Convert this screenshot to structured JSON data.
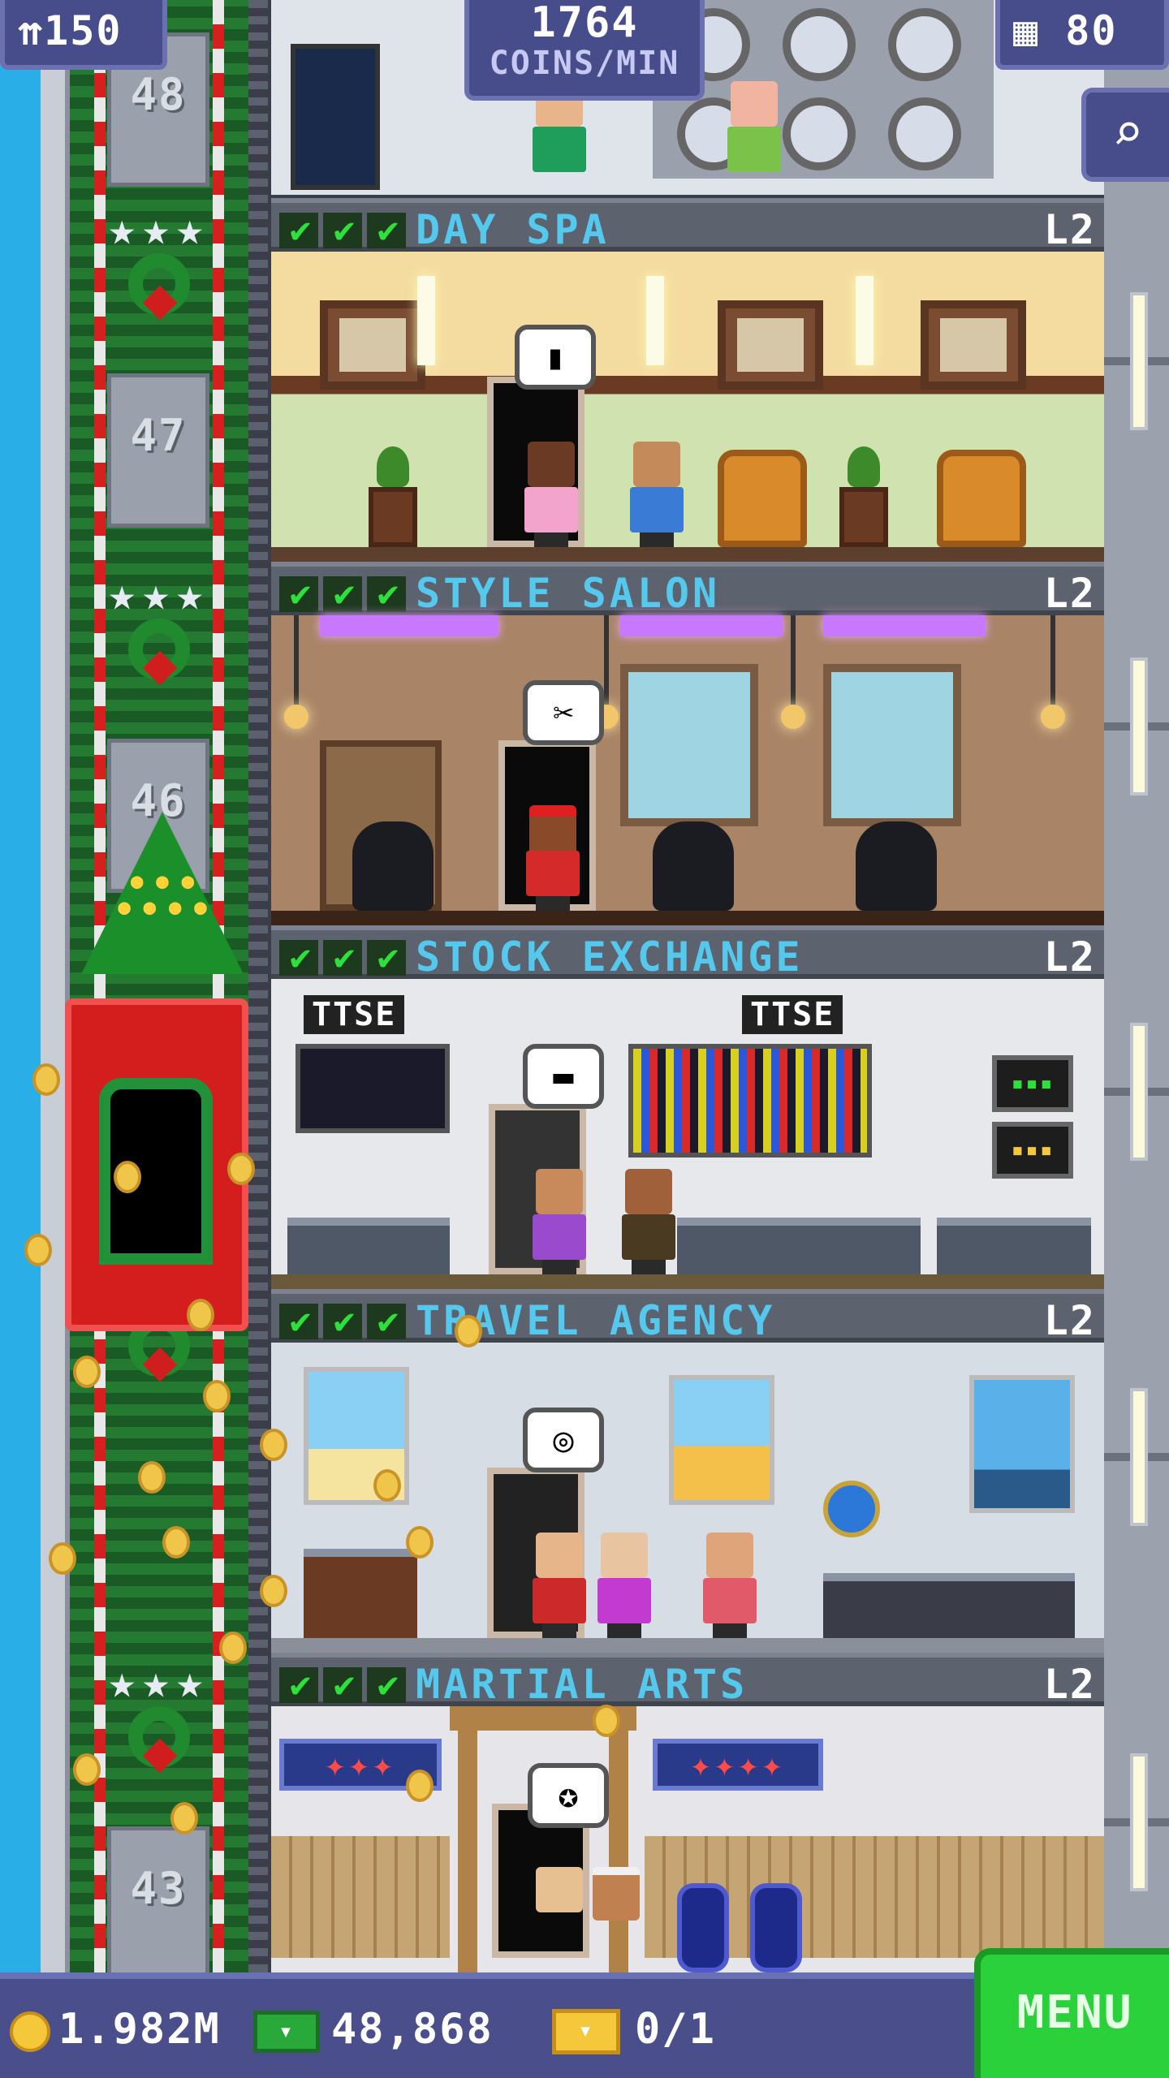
{
  "hud": {
    "population": "150",
    "coins_rate_value": "1764",
    "coins_rate_unit": "COINS/MIN",
    "floors_built": "80"
  },
  "icons": {
    "population": "person-stack-icon",
    "floors": "building-grid-icon",
    "search": "magnifier-icon",
    "coins": "coin-icon",
    "bux": "bux-cash-icon",
    "ticket": "golden-ticket-icon"
  },
  "elevator": {
    "shaft_floor_numbers": [
      "48",
      "47",
      "46",
      "43"
    ]
  },
  "floors": [
    {
      "name": "DAY SPA",
      "level": "L2",
      "checks": 3
    },
    {
      "name": "STYLE SALON",
      "level": "L2",
      "checks": 3
    },
    {
      "name": "STOCK EXCHANGE",
      "level": "L2",
      "checks": 3,
      "signs": [
        "TTSE",
        "TTSE"
      ]
    },
    {
      "name": "TRAVEL AGENCY",
      "level": "L2",
      "checks": 3
    },
    {
      "name": "MARTIAL ARTS",
      "level": "L2",
      "checks": 3
    }
  ],
  "bottom_bar": {
    "coins": "1.982M",
    "bux": "48,868",
    "tickets": "0/1",
    "menu_label": "MENU"
  },
  "colors": {
    "hud_bg": "#474c8a",
    "floor_name": "#55c8ee",
    "check": "#2ee03b",
    "menu_green": "#2bd13a",
    "coin_gold": "#f4c83a"
  }
}
